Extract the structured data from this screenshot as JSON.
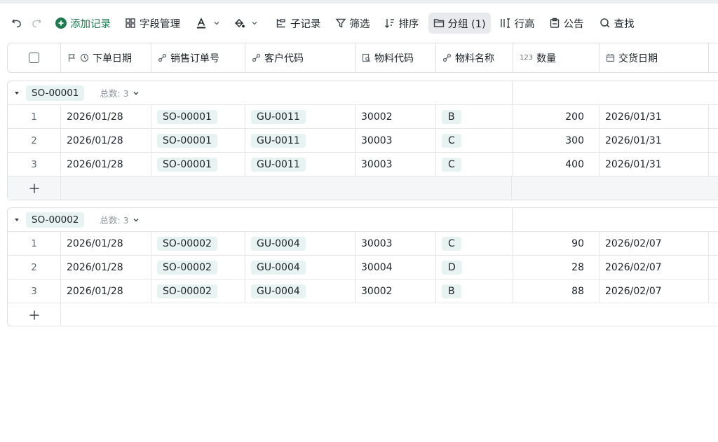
{
  "toolbar": {
    "add_record": "添加记录",
    "field_manage": "字段管理",
    "sub_record": "子记录",
    "filter": "筛选",
    "sort": "排序",
    "group": "分组 (1)",
    "row_height": "行高",
    "notice": "公告",
    "find": "查找"
  },
  "columns": [
    "下单日期",
    "销售订单号",
    "客户代码",
    "物料代码",
    "物料名称",
    "数量",
    "交货日期"
  ],
  "number_icon_text": "123",
  "groups": [
    {
      "name": "SO-00001",
      "count_label": "总数: 3",
      "rows": [
        {
          "idx": "1",
          "date": "2026/01/28",
          "order": "SO-00001",
          "customer": "GU-0011",
          "material_code": "30002",
          "material_name": "B",
          "qty": "200",
          "delivery": "2026/01/31"
        },
        {
          "idx": "2",
          "date": "2026/01/28",
          "order": "SO-00001",
          "customer": "GU-0011",
          "material_code": "30003",
          "material_name": "C",
          "qty": "300",
          "delivery": "2026/01/31"
        },
        {
          "idx": "3",
          "date": "2026/01/28",
          "order": "SO-00001",
          "customer": "GU-0011",
          "material_code": "30003",
          "material_name": "C",
          "qty": "400",
          "delivery": "2026/01/31"
        }
      ]
    },
    {
      "name": "SO-00002",
      "count_label": "总数: 3",
      "rows": [
        {
          "idx": "1",
          "date": "2026/01/28",
          "order": "SO-00002",
          "customer": "GU-0004",
          "material_code": "30003",
          "material_name": "C",
          "qty": "90",
          "delivery": "2026/02/07"
        },
        {
          "idx": "2",
          "date": "2026/01/28",
          "order": "SO-00002",
          "customer": "GU-0004",
          "material_code": "30004",
          "material_name": "D",
          "qty": "28",
          "delivery": "2026/02/07"
        },
        {
          "idx": "3",
          "date": "2026/01/28",
          "order": "SO-00002",
          "customer": "GU-0004",
          "material_code": "30002",
          "material_name": "B",
          "qty": "88",
          "delivery": "2026/02/07"
        }
      ]
    }
  ],
  "colors": {
    "accent": "#1f7a4f",
    "chip_bg": "#e6f3f1",
    "border": "#dee0e3"
  }
}
